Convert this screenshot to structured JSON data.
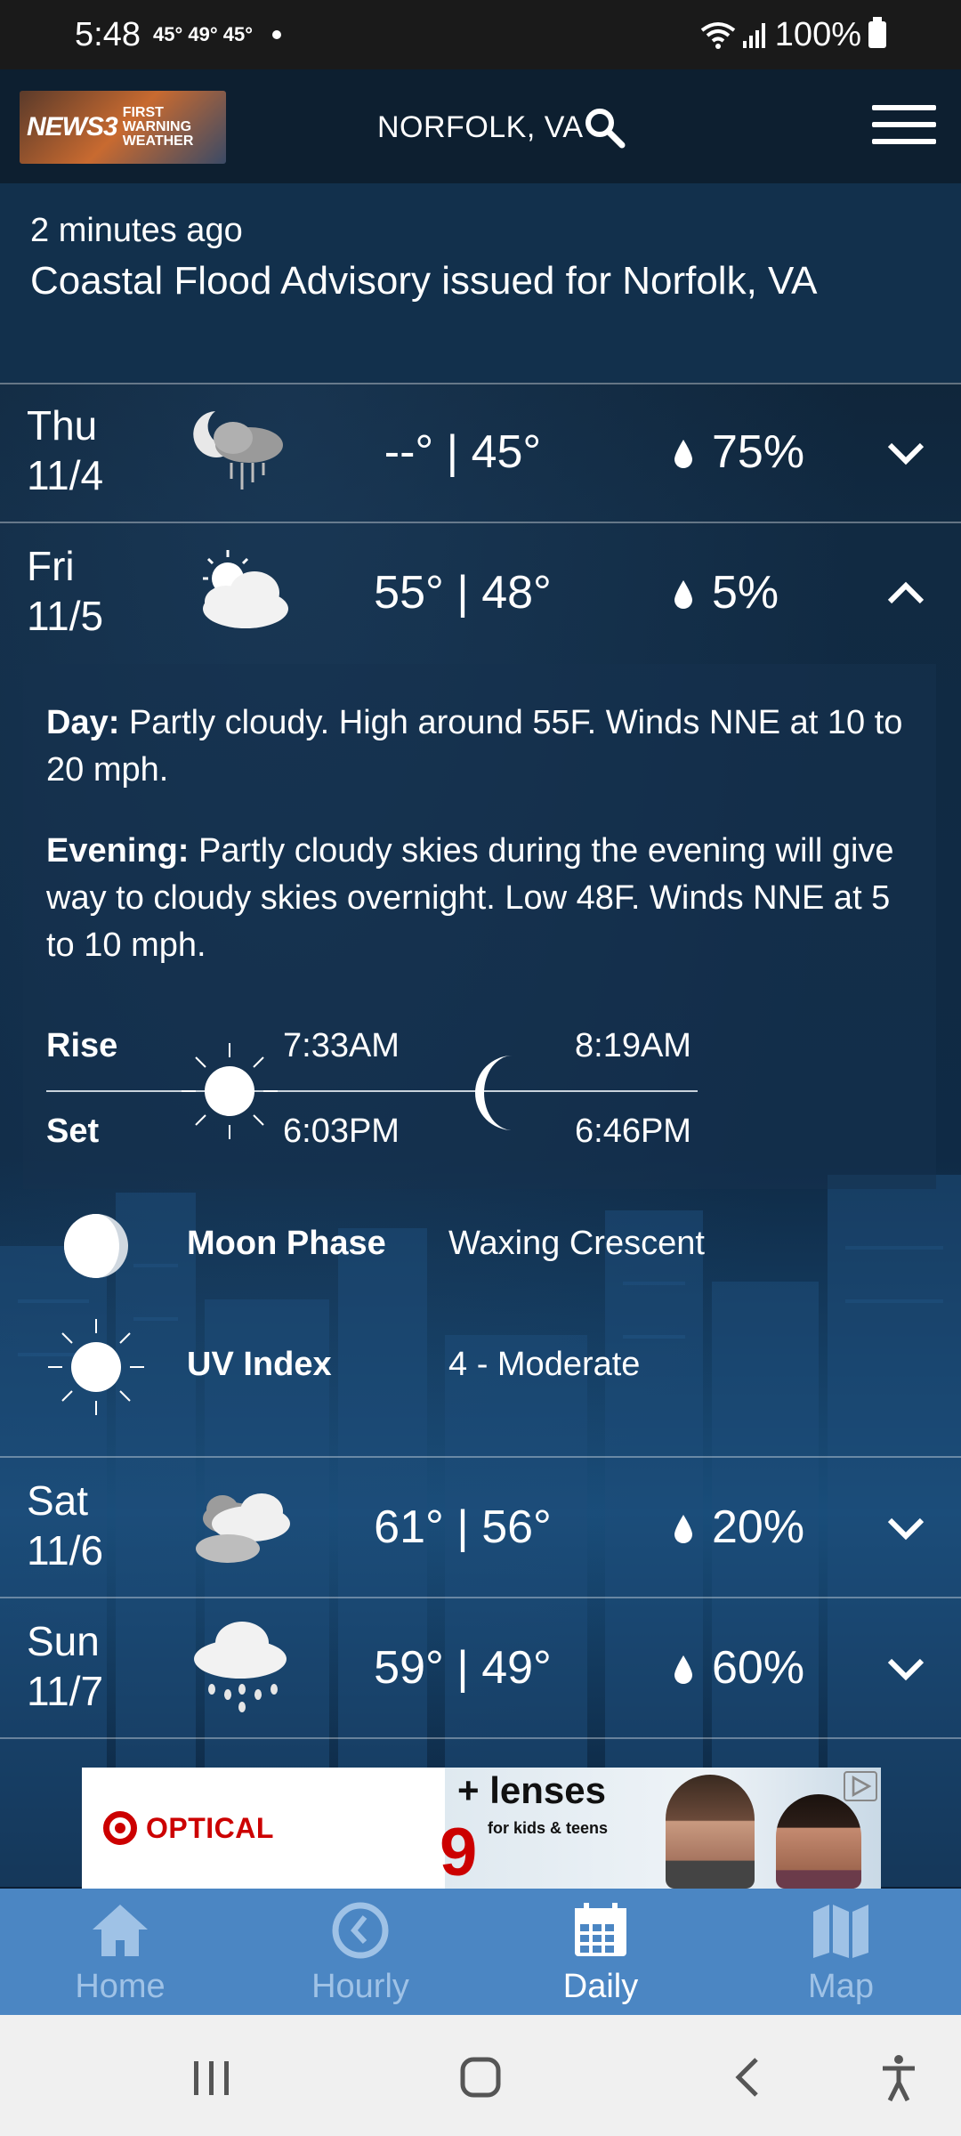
{
  "status_bar": {
    "time": "5:48",
    "temps": "45° 49° 45°",
    "battery": "100%"
  },
  "header": {
    "logo_main": "NEWS3",
    "logo_sub1": "FIRST",
    "logo_sub2": "WARNING",
    "logo_sub3": "WEATHER",
    "location": "NORFOLK, VA",
    "icons": [
      "search-icon",
      "hamburger-menu-icon"
    ]
  },
  "alert": {
    "time": "2 minutes ago",
    "title": "Coastal Flood Advisory issued for Norfolk, VA"
  },
  "days": [
    {
      "day": "Thu",
      "date": "11/4",
      "temps": "--° | 45°",
      "precip": "75%",
      "icon": "night-rain-icon",
      "expanded": false
    },
    {
      "day": "Fri",
      "date": "11/5",
      "temps": "55° | 48°",
      "precip": "5%",
      "icon": "partly-cloudy-icon",
      "expanded": true
    },
    {
      "day": "Sat",
      "date": "11/6",
      "temps": "61° | 56°",
      "precip": "20%",
      "icon": "cloudy-icon",
      "expanded": false
    },
    {
      "day": "Sun",
      "date": "11/7",
      "temps": "59° | 49°",
      "precip": "60%",
      "icon": "rain-icon",
      "expanded": false
    }
  ],
  "detail": {
    "day_label": "Day:",
    "day_text": "Partly cloudy. High around 55F. Winds NNE at 10 to 20 mph.",
    "evening_label": "Evening:",
    "evening_text": "Partly cloudy skies during the evening will give way to cloudy skies overnight. Low 48F. Winds NNE at 5 to 10 mph.",
    "rise_label": "Rise",
    "set_label": "Set",
    "sunrise": "7:33AM",
    "sunset": "6:03PM",
    "moonrise": "8:19AM",
    "moonset": "6:46PM",
    "moon_phase_label": "Moon Phase",
    "moon_phase_value": "Waxing Crescent",
    "uv_label": "UV Index",
    "uv_value": "4 - Moderate"
  },
  "ad": {
    "brand": "OPTICAL",
    "headline": "+ lenses",
    "sub": "for kids & teens",
    "number": "9"
  },
  "nav": [
    {
      "label": "Home",
      "icon": "home-icon",
      "active": false
    },
    {
      "label": "Hourly",
      "icon": "clock-icon",
      "active": false
    },
    {
      "label": "Daily",
      "icon": "calendar-icon",
      "active": true
    },
    {
      "label": "Map",
      "icon": "map-icon",
      "active": false
    }
  ],
  "colors": {
    "nav_bg": "#4b86c3",
    "nav_inactive": "#9fc2e6",
    "ad_red": "#cc0000"
  }
}
